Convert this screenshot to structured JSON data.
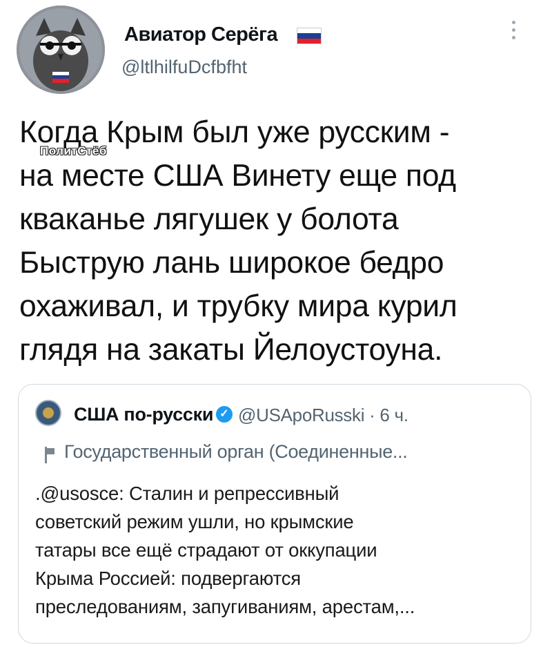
{
  "author": {
    "name": "Авиатор Серёга",
    "handle": "@ltlhilfuDcfbfht",
    "flag_colors": [
      "#ffffff",
      "#1c3f94",
      "#e4202a"
    ]
  },
  "tweet": {
    "lines": [
      "Когда Крым был уже русским -",
      "на месте США Винету еще под",
      "кваканье лягушек у болота",
      "Быструю лань широкое бедро",
      "охаживал, и трубку мира курил",
      "глядя на закаты Йелоустоуна."
    ],
    "watermark": "ПолитСтёб"
  },
  "quote": {
    "name": "США по-русски",
    "meta": "@USApoRusski · 6 ч.",
    "label": "Государственный орган (Соединенные...",
    "lines": [
      ".@usosce: Сталин и репрессивный",
      "советский режим ушли, но крымские",
      "татары все ещё страдают от оккупации",
      "Крыма Россией: подвергаются",
      "преследованиям, запугиваниям, арестам,..."
    ]
  },
  "icons": {
    "more": "more-vertical-icon",
    "verified": "verified-badge-icon",
    "government": "government-flag-icon"
  }
}
